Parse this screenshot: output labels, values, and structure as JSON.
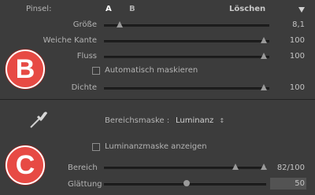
{
  "brush": {
    "label": "Pinsel:",
    "tab_a": "A",
    "tab_b": "B",
    "erase": "Löschen",
    "menu_icon": "triangle-down-icon"
  },
  "sliders": {
    "size": {
      "label": "Größe",
      "value": "8,1"
    },
    "feather": {
      "label": "Weiche Kante",
      "value": "100"
    },
    "flow": {
      "label": "Fluss",
      "value": "100"
    },
    "density": {
      "label": "Dichte",
      "value": "100"
    }
  },
  "automask": {
    "label": "Automatisch maskieren",
    "checked": false
  },
  "badges": {
    "b": "B",
    "c": "C"
  },
  "range_mask": {
    "label": "Bereichsmaske :",
    "value": "Luminanz",
    "show_mask_label": "Luminanzmaske anzeigen",
    "range_label": "Bereich",
    "range_value": "82/100",
    "smooth_label": "Glättung",
    "smooth_value": "50"
  },
  "colors": {
    "badge": "#e74a44",
    "panel": "#3c3c3c"
  }
}
